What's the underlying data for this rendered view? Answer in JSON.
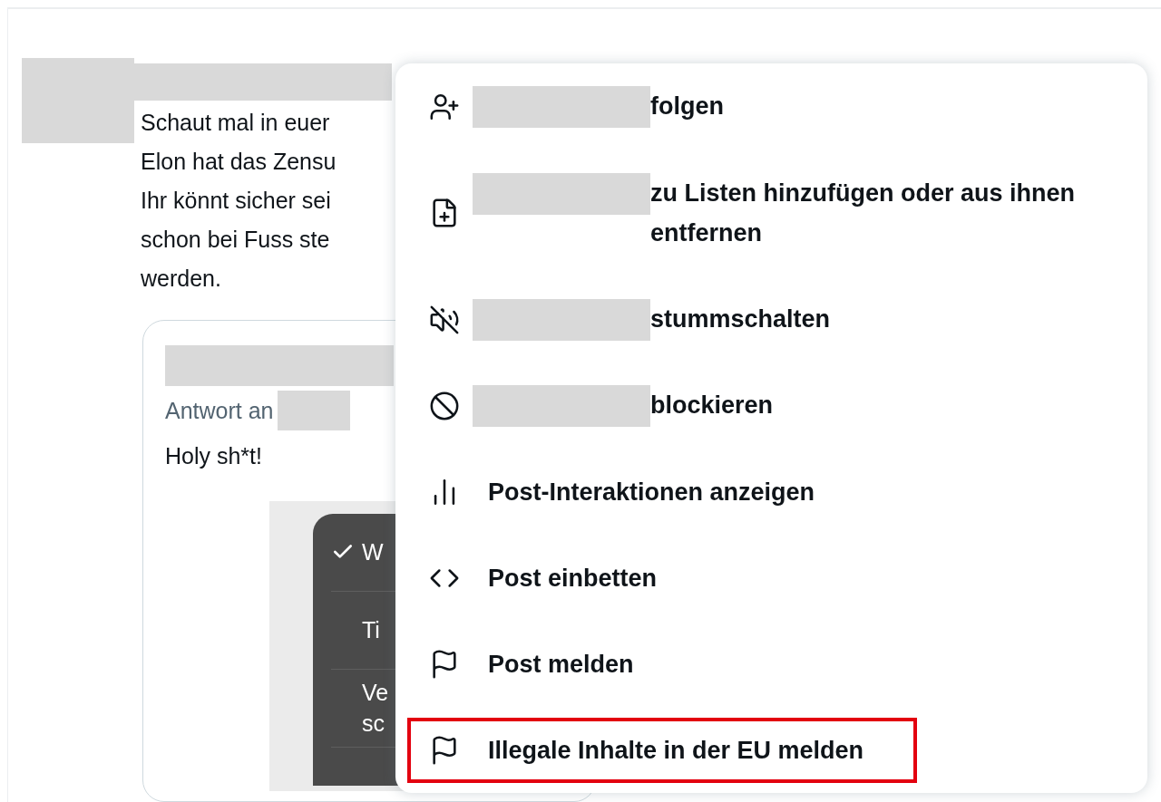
{
  "post": {
    "text_lines": [
      "Schaut mal in euer",
      "Elon hat das Zensu",
      "Ihr könnt sicher sei",
      "schon bei Fuss ste",
      "werden."
    ],
    "quote": {
      "reply_label": "Antwort an",
      "text": "Holy sh*t!",
      "image_menu": [
        {
          "lines": [
            "W"
          ],
          "checked": true
        },
        {
          "lines": [
            "Ti"
          ],
          "checked": false
        },
        {
          "lines": [
            "Ve",
            "sc"
          ],
          "checked": false
        }
      ]
    }
  },
  "menu": [
    {
      "kind": "user",
      "label": "folgen",
      "highlighted": false
    },
    {
      "kind": "user",
      "label": "zu Listen hinzufügen oder aus ihnen entfernen",
      "highlighted": false
    },
    {
      "kind": "user",
      "label": "stummschalten",
      "highlighted": false
    },
    {
      "kind": "user",
      "label": "blockieren",
      "highlighted": false
    },
    {
      "kind": "plain",
      "label": "Post-Interaktionen anzeigen",
      "highlighted": false
    },
    {
      "kind": "plain",
      "label": "Post einbetten",
      "highlighted": false
    },
    {
      "kind": "plain",
      "label": "Post melden",
      "highlighted": false
    },
    {
      "kind": "plain",
      "label": "Illegale Inhalte in der EU melden",
      "highlighted": true
    }
  ]
}
